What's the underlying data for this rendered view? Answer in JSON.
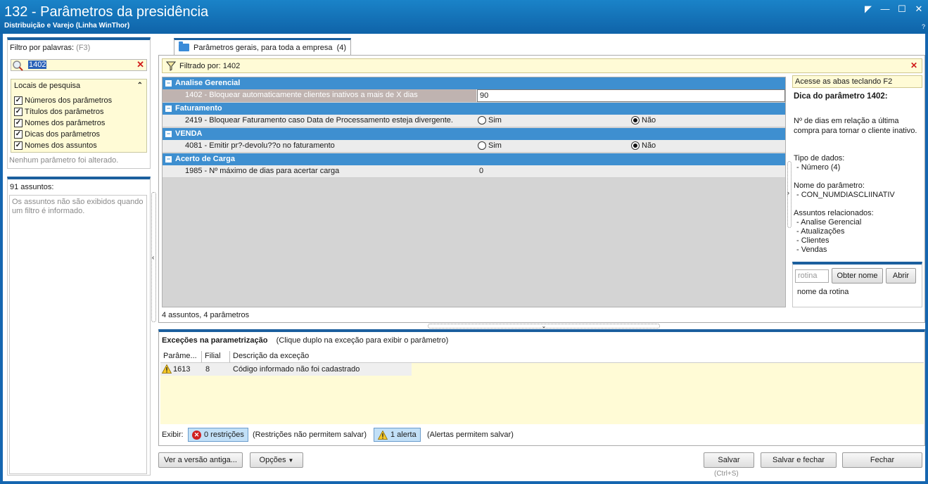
{
  "window": {
    "title": "132 - Parâmetros da presidência",
    "subtitle": "Distribuição e Varejo (Linha WinThor)",
    "corner_mark": "?",
    "buttons": [
      "restore-alt",
      "minimize",
      "maximize",
      "close"
    ]
  },
  "filter": {
    "label": "Filtro por palavras:",
    "shortcut": "(F3)",
    "value": "1402",
    "locais_label": "Locais de pesquisa",
    "options": [
      {
        "label": "Números dos parâmetros",
        "checked": true
      },
      {
        "label": "Títulos dos parâmetros",
        "checked": true
      },
      {
        "label": "Nomes dos parâmetros",
        "checked": true
      },
      {
        "label": "Dicas dos parâmetros",
        "checked": true
      },
      {
        "label": "Nomes dos assuntos",
        "checked": true
      }
    ],
    "status": "Nenhum parâmetro foi alterado."
  },
  "subjects": {
    "count_label": "91 assuntos:",
    "empty_text": "Os assuntos não são exibidos quando um filtro é informado."
  },
  "tab": {
    "label": "Parâmetros gerais, para toda a empresa",
    "count": "(4)"
  },
  "filterbar": {
    "text": "Filtrado por: 1402"
  },
  "groups": [
    {
      "name": "Analise Gerencial",
      "params": [
        {
          "label": "1402 - Bloquear automaticamente clientes inativos a mais de X dias",
          "type": "number",
          "value": "90",
          "selected": true
        }
      ]
    },
    {
      "name": "Faturamento",
      "params": [
        {
          "label": "2419 - Bloquear Faturamento caso Data de Processamento esteja divergente.",
          "type": "bool",
          "yes": "Sim",
          "no": "Não",
          "value": "no"
        }
      ]
    },
    {
      "name": "VENDA",
      "params": [
        {
          "label": "4081 - Emitir pr?-devolu??o no faturamento",
          "type": "bool",
          "yes": "Sim",
          "no": "Não",
          "value": "no"
        }
      ]
    },
    {
      "name": "Acerto de Carga",
      "params": [
        {
          "label": "1985 - Nº máximo de dias para acertar carga",
          "type": "number",
          "value": "0"
        }
      ]
    }
  ],
  "grid_footer": "4 assuntos, 4 parâmetros",
  "tips": {
    "hint": "Acesse as abas teclando F2",
    "title": "Dica do parâmetro 1402:",
    "desc_lines": [
      "Nº de dias em relação a última",
      "compra para tornar o cliente inativo."
    ],
    "data_type_label": "Tipo de dados:",
    "data_type_value": "- Número (4)",
    "param_name_label": "Nome do parâmetro:",
    "param_name_value": "- CON_NUMDIASCLIINATIV",
    "related_label": "Assuntos relacionados:",
    "related": [
      "- Analise Gerencial",
      "- Atualizações",
      "- Clientes",
      "- Vendas"
    ]
  },
  "rotina": {
    "placeholder": "rotina",
    "obter_nome": "Obter nome",
    "abrir": "Abrir",
    "caption": "nome da rotina"
  },
  "exceptions": {
    "title": "Exceções na parametrização",
    "hint": "(Clique duplo na exceção para exibir o parâmetro)",
    "columns": [
      "Parâme...",
      "Filial",
      "Descrição da exceção"
    ],
    "rows": [
      {
        "param": "1613",
        "filial": "8",
        "desc": "Código informado não foi cadastrado"
      }
    ],
    "show_label": "Exibir:",
    "restrictions_badge": "0 restrições",
    "restrictions_note": "(Restrições não permitem salvar)",
    "alerts_badge": "1 alerta",
    "alerts_note": "(Alertas permitem salvar)"
  },
  "footer": {
    "old_version": "Ver a versão antiga...",
    "options": "Opções",
    "save": "Salvar",
    "save_shortcut": "(Ctrl+S)",
    "save_close": "Salvar e fechar",
    "close": "Fechar"
  },
  "colors": {
    "accent": "#1b5f9e",
    "group_header": "#3e8fd0",
    "highlight_yellow": "#fffbd6"
  }
}
